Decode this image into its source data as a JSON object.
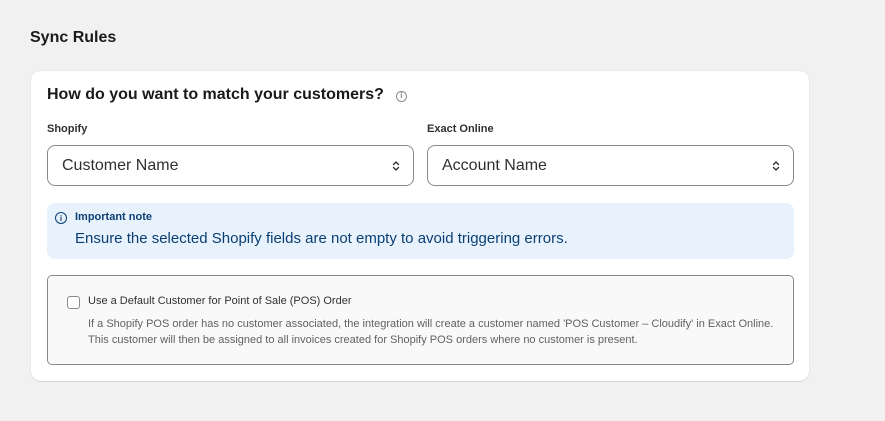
{
  "section_title": "Sync Rules",
  "card": {
    "heading": "How do you want to match your customers?",
    "info_icon_glyph": "i",
    "shopify": {
      "label": "Shopify",
      "selected": "Customer Name"
    },
    "exact": {
      "label": "Exact Online",
      "selected": "Account Name"
    },
    "note": {
      "icon_glyph": "i",
      "title": "Important note",
      "body": "Ensure the selected Shopify fields are not empty to avoid triggering errors."
    },
    "pos": {
      "checked": false,
      "label": "Use a Default Customer for Point of Sale (POS) Order",
      "help": "If a Shopify POS order has no customer associated, the integration will create a customer named 'POS Customer – Cloudify' in Exact Online. This customer will then be assigned to all invoices created for Shopify POS orders where no customer is present."
    }
  },
  "colors": {
    "background": "#f1f1f1",
    "card": "#ffffff",
    "note_background": "#e8f2fc",
    "note_text": "#0b3f74",
    "border": "#8a8a8a"
  }
}
